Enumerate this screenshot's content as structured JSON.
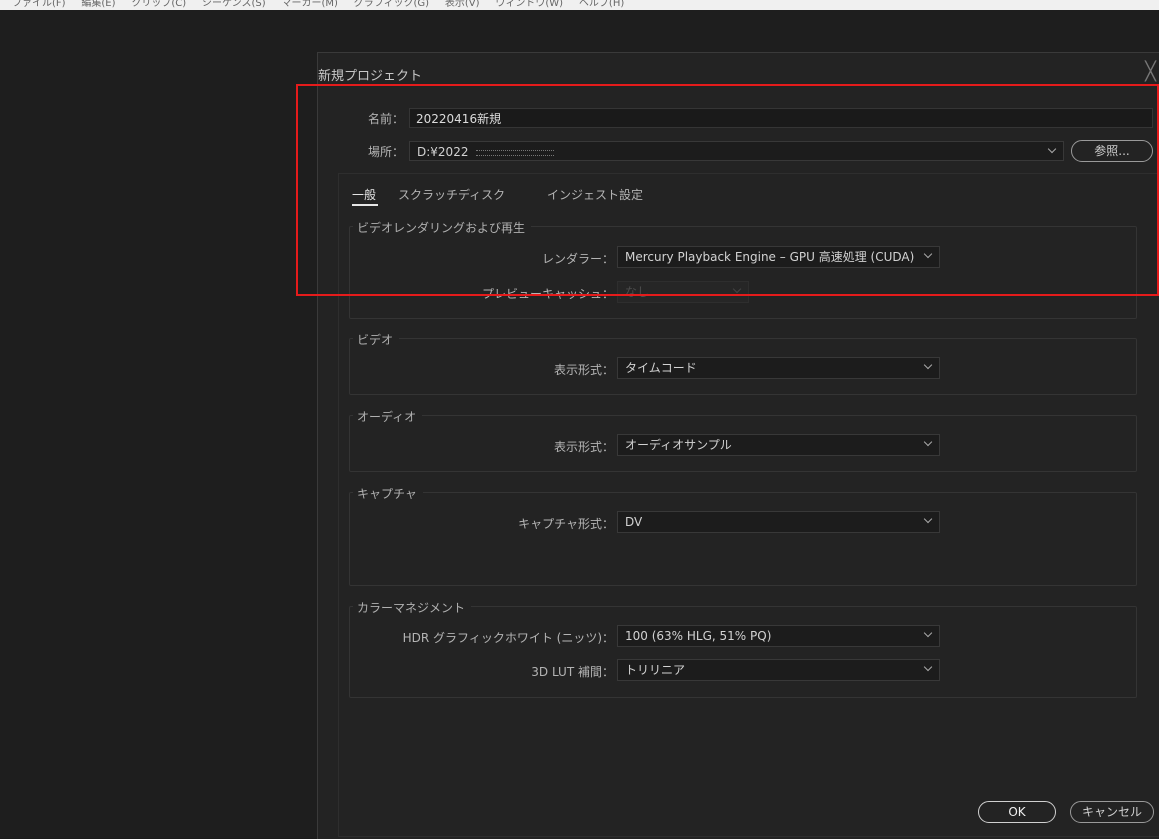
{
  "menubar": {
    "items": [
      "ファイル(F)",
      "編集(E)",
      "クリップ(C)",
      "シーケンス(S)",
      "マーカー(M)",
      "グラフィック(G)",
      "表示(V)",
      "ウィンドウ(W)",
      "ヘルプ(H)"
    ]
  },
  "dialog": {
    "title": "新規プロジェクト",
    "close_glyph": "╳",
    "name_label": "名前：",
    "name_value": "20220416新規",
    "location_label": "場所：",
    "location_value": "D:¥2022",
    "browse_label": "参照...",
    "tabs": [
      "一般",
      "スクラッチディスク",
      "インジェスト設定"
    ],
    "sections": {
      "video_render": {
        "title": "ビデオレンダリングおよび再生",
        "renderer_label": "レンダラー：",
        "renderer_value": "Mercury Playback Engine – GPU 高速処理 (CUDA)",
        "preview_cache_label": "プレビューキャッシュ：",
        "preview_cache_value": "なし"
      },
      "video": {
        "title": "ビデオ",
        "display_format_label": "表示形式：",
        "display_format_value": "タイムコード"
      },
      "audio": {
        "title": "オーディオ",
        "display_format_label": "表示形式：",
        "display_format_value": "オーディオサンプル"
      },
      "capture": {
        "title": "キャプチャ",
        "capture_format_label": "キャプチャ形式：",
        "capture_format_value": "DV"
      },
      "color": {
        "title": "カラーマネジメント",
        "hdr_label": "HDR グラフィックホワイト (ニッツ)：",
        "hdr_value": "100 (63% HLG, 51% PQ)",
        "lut_label": "3D LUT 補間：",
        "lut_value": "トリリニア"
      }
    },
    "ok_label": "OK",
    "cancel_label": "キャンセル"
  },
  "colors": {
    "highlight_box": "#e51b1b",
    "dialog_bg": "#232323",
    "app_bg": "#1e1e1e"
  }
}
